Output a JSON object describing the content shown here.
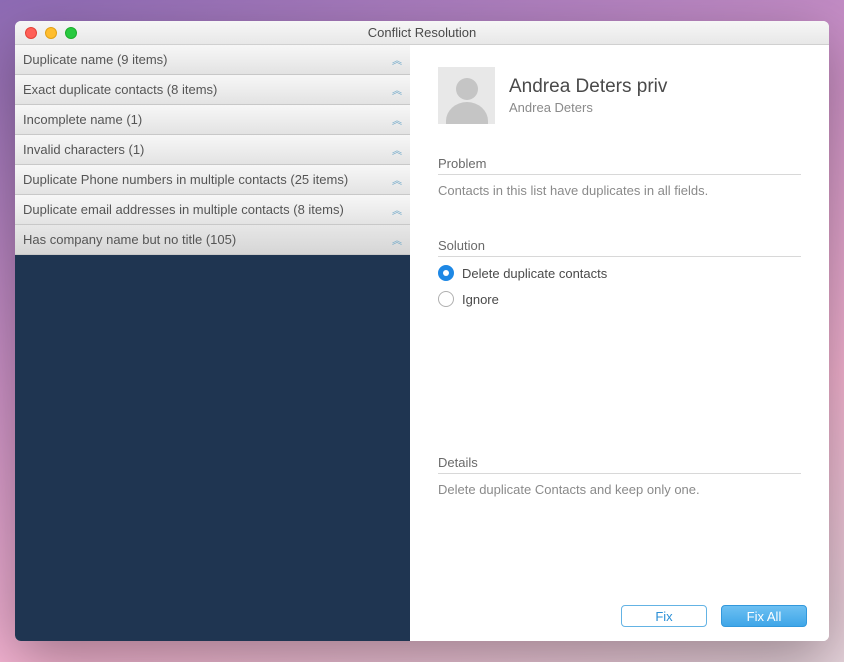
{
  "window": {
    "title": "Conflict Resolution"
  },
  "sidebar": {
    "items": [
      {
        "label": "Duplicate name (9 items)"
      },
      {
        "label": "Exact duplicate contacts (8 items)"
      },
      {
        "label": "Incomplete name (1)"
      },
      {
        "label": "Invalid characters (1)"
      },
      {
        "label": "Duplicate Phone numbers in multiple contacts (25 items)"
      },
      {
        "label": "Duplicate email addresses in multiple contacts (8 items)"
      },
      {
        "label": "Has company name but no title (105)"
      }
    ]
  },
  "contact": {
    "name": "Andrea Deters priv",
    "subtitle": "Andrea Deters"
  },
  "problem": {
    "heading": "Problem",
    "text": "Contacts in this list have duplicates in all fields."
  },
  "solution": {
    "heading": "Solution",
    "options": [
      {
        "label": "Delete duplicate contacts"
      },
      {
        "label": "Ignore"
      }
    ]
  },
  "details": {
    "heading": "Details",
    "text": "Delete duplicate Contacts and keep only one."
  },
  "buttons": {
    "fix": "Fix",
    "fixAll": "Fix All"
  }
}
